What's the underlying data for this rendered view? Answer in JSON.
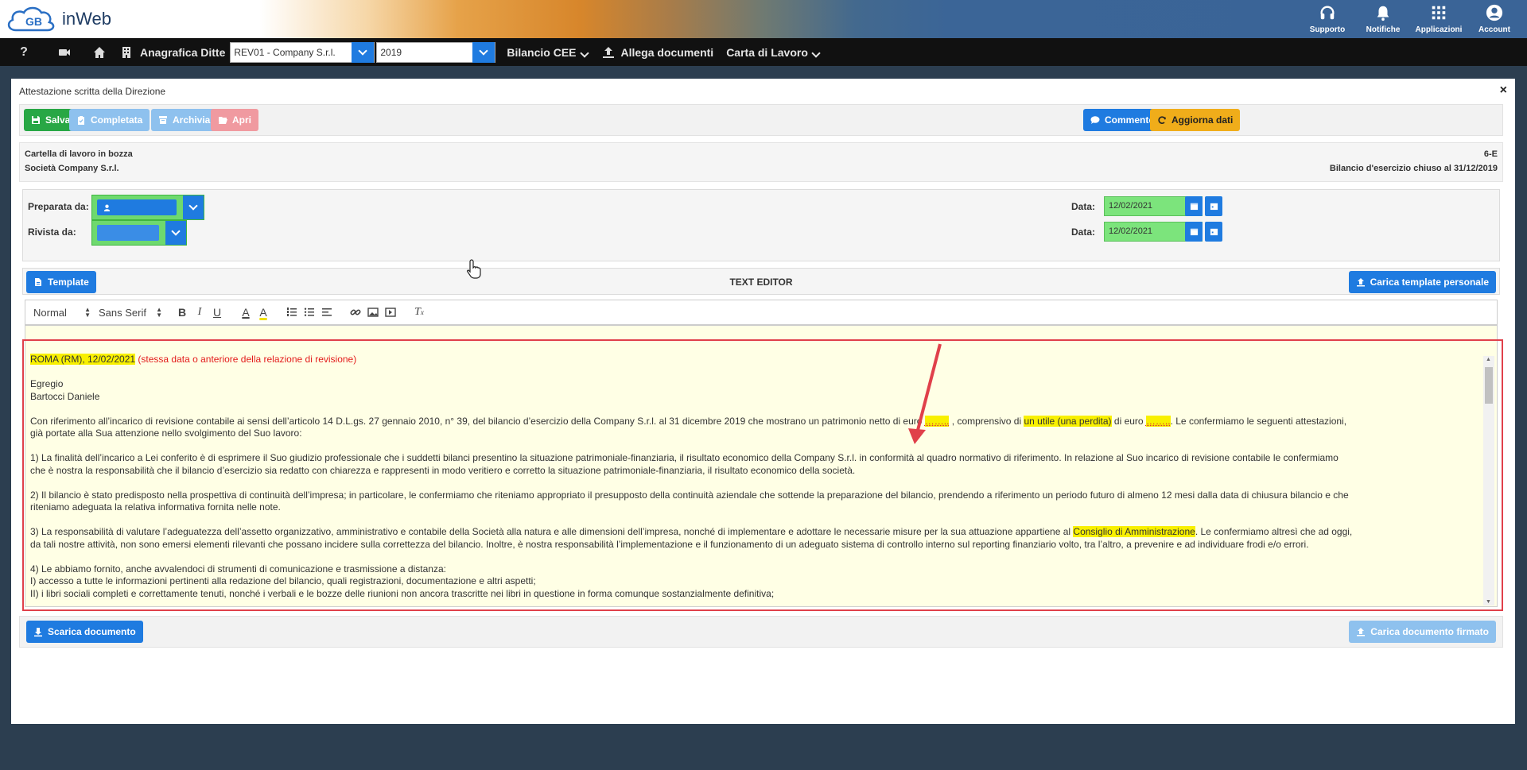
{
  "topbar": {
    "brand": "inWeb",
    "logo_letters": "GB",
    "icons": [
      {
        "icon": "headset-icon",
        "label": "Supporto"
      },
      {
        "icon": "bell-icon",
        "label": "Notifiche"
      },
      {
        "icon": "grid-icon",
        "label": "Applicazioni"
      },
      {
        "icon": "user-icon",
        "label": "Account"
      }
    ]
  },
  "navbar": {
    "help": "?",
    "anagrafica_label": "Anagrafica Ditte",
    "company_select": "REV01 - Company S.r.l.",
    "year_select": "2019",
    "bilancio_label": "Bilancio CEE",
    "allega_label": "Allega documenti",
    "carta_label": "Carta di Lavoro"
  },
  "window": {
    "title": "Attestazione scritta della Direzione",
    "close": "×"
  },
  "toolbar": {
    "salva": "Salva",
    "completata": "Completata",
    "archivia": "Archivia",
    "apri": "Apri",
    "commento": "Commento",
    "aggiorna": "Aggiorna dati"
  },
  "info": {
    "status": "Cartella di lavoro in bozza",
    "company": "Società Company S.r.l.",
    "code": "6-E",
    "bilancio": "Bilancio d'esercizio chiuso al 31/12/2019"
  },
  "prep": {
    "preparata_label": "Preparata da:",
    "rivista_label": "Rivista da:",
    "data_label": "Data:",
    "date_1": "12/02/2021",
    "date_2": "12/02/2021"
  },
  "editor_head": {
    "template_btn": "Template",
    "title": "TEXT EDITOR",
    "carica_template": "Carica template personale"
  },
  "ql_toolbar": {
    "heading": "Normal",
    "font": "Sans Serif"
  },
  "letter": {
    "place_date": "ROMA (RM), 12/02/2021",
    "place_note": " (stessa data o anteriore della relazione di revisione)",
    "greeting": "Egregio",
    "recipient": "Bartocci Daniele",
    "p1_a": "Con riferimento all’incarico di revisione contabile ai sensi dell’articolo 14 D.L.gs. 27 gennaio 2010, n° 39, del bilancio d’esercizio della Company S.r.l. al 31 dicembre 2019 che mostrano un patrimonio netto di euro ",
    "dots1": "……..",
    "p1_b": " , comprensivo di ",
    "utile": "un utile (una perdita)",
    "p1_c": " di euro ",
    "dots2": "……..",
    "p1_d": ". Le confermiamo le seguenti attestazioni,",
    "p1_e": "già portate alla Sua attenzione nello svolgimento del Suo lavoro:",
    "p2_a": "1) La finalità dell’incarico a Lei conferito è di esprimere il Suo giudizio professionale che i suddetti bilanci presentino la situazione patrimoniale-finanziaria, il risultato economico della Company S.r.l. in conformità al quadro normativo di riferimento. In relazione al Suo incarico di revisione contabile le confermiamo",
    "p2_b": "che è nostra la responsabilità che il bilancio d’esercizio sia redatto con chiarezza e rappresenti in modo veritiero e corretto la situazione patrimoniale-finanziaria, il risultato economico della società.",
    "p3_a": "2) Il bilancio è stato predisposto nella prospettiva di continuità dell’impresa; in particolare, le confermiamo che riteniamo appropriato il presupposto della continuità aziendale che sottende la preparazione del bilancio, prendendo a riferimento un periodo futuro di almeno 12 mesi dalla data di chiusura bilancio e che",
    "p3_b": "riteniamo adeguata la relativa informativa fornita nelle note.",
    "p4_a": "3) La responsabilità di valutare l’adeguatezza dell’assetto organizzativo, amministrativo e contabile della Società alla natura e alle dimensioni dell’impresa, nonché di implementare e adottare le necessarie misure per la sua attuazione appartiene al ",
    "consiglio": "Consiglio di Amministrazione",
    "p4_b": ". Le confermiamo altresì che ad oggi,",
    "p4_c": "da tali nostre attività, non sono emersi elementi rilevanti che possano incidere sulla correttezza del bilancio. Inoltre, è nostra responsabilità l’implementazione e il funzionamento di un adeguato sistema di controllo interno sul reporting finanziario volto, tra l’altro, a prevenire e ad individuare frodi e/o errori.",
    "p5_a": "4) Le abbiamo fornito, anche avvalendoci di strumenti di comunicazione e trasmissione a distanza:",
    "p5_b": "I)  accesso a tutte le informazioni pertinenti alla redazione del bilancio, quali registrazioni, documentazione e altri aspetti;",
    "p5_c": "II) i libri sociali completi e correttamente tenuti, nonché i verbali e le bozze delle riunioni non ancora trascritte nei libri in questione in forma comunque sostanzialmente definitiva;"
  },
  "bottom": {
    "scarica": "Scarica documento",
    "carica_firmato": "Carica documento firmato"
  },
  "colors": {
    "blue": "#1f7be0",
    "green": "#28a745",
    "orange": "#f0ad1a",
    "highlight": "#f8f000",
    "frame_red": "#e0404a"
  }
}
